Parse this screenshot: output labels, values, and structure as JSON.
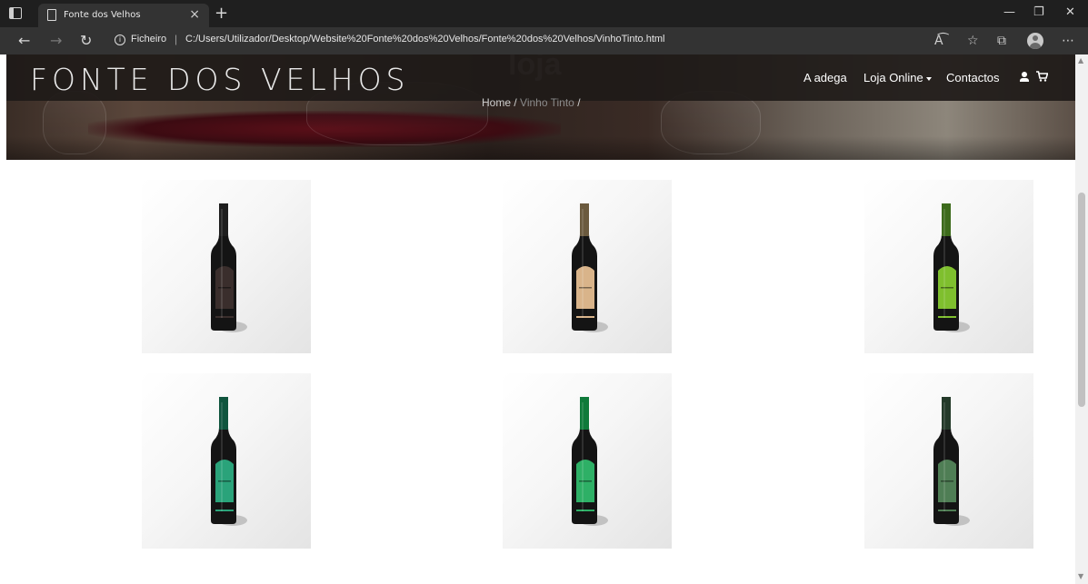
{
  "browser": {
    "tab_title": "Fonte dos Velhos",
    "tab_close": "×",
    "new_tab": "+",
    "address_label": "Ficheiro",
    "address_separator": "|",
    "url": "C:/Users/Utilizador/Desktop/Website%20Fonte%20dos%20Velhos/Fonte%20dos%20Velhos/VinhoTinto.html",
    "icons": [
      "tab-actions-icon",
      "page-icon",
      "back-icon",
      "forward-icon",
      "refresh-icon",
      "info-icon",
      "read-aloud-icon",
      "favorites-icon",
      "collections-icon",
      "profile-icon",
      "more-icon",
      "minimize-icon",
      "restore-icon",
      "close-icon"
    ]
  },
  "site": {
    "logo": "FONTE DOS VELHOS",
    "hero_title": "loja",
    "breadcrumb": {
      "home": "Home",
      "current": "Vinho Tinto"
    },
    "nav": {
      "adega": "A adega",
      "loja": "Loja Online",
      "contactos": "Contactos"
    },
    "nav_icons": [
      "user-icon",
      "cart-icon",
      "caret-down-icon"
    ]
  },
  "products": [
    {
      "name": "bottle-dark",
      "label_color": "#3a2e2c",
      "capsule_color": "#1e1e1e"
    },
    {
      "name": "bottle-beige",
      "label_color": "#d9b48a",
      "capsule_color": "#6b5a3e"
    },
    {
      "name": "bottle-lime",
      "label_color": "#7fbf2e",
      "capsule_color": "#3d6b1c"
    },
    {
      "name": "bottle-teal",
      "label_color": "#2aa37a",
      "capsule_color": "#10553e"
    },
    {
      "name": "bottle-green",
      "label_color": "#2eb066",
      "capsule_color": "#0f7a3a"
    },
    {
      "name": "bottle-olive",
      "label_color": "#4f7e55",
      "capsule_color": "#243a2a"
    }
  ]
}
